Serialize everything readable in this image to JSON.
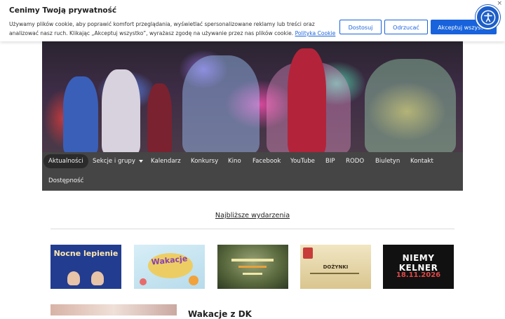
{
  "cookie_banner": {
    "title": "Cenimy Twoją prywatność",
    "text": "Używamy plików cookie, aby poprawić komfort przeglądania, wyświetlać spersonalizowane reklamy lub treści oraz analizować nasz ruch. Klikając „Akceptuj wszystko”, wyrażasz zgodę na używanie przez nas plików cookie.",
    "policy_link": "Polityka Cookie",
    "buttons": {
      "customize": "Dostosuj",
      "reject": "Odrzucać",
      "accept_all": "Akceptuj wszystko"
    },
    "close": "×"
  },
  "accessibility_widget": {
    "icon": "accessibility-icon"
  },
  "nav": {
    "items": [
      {
        "label": "Aktualności",
        "active": true
      },
      {
        "label": "Sekcje i grupy",
        "has_dropdown": true
      },
      {
        "label": "Kalendarz"
      },
      {
        "label": "Konkursy"
      },
      {
        "label": "Kino"
      },
      {
        "label": "Facebook"
      },
      {
        "label": "YouTube"
      },
      {
        "label": "BIP"
      },
      {
        "label": "RODO"
      },
      {
        "label": "Biuletyn"
      },
      {
        "label": "Kontakt"
      },
      {
        "label": "Dostępność"
      }
    ]
  },
  "events": {
    "heading": "Najbliższe wydarzenia",
    "items": [
      {
        "caption": "Nocne lepienie",
        "bg": "#223c8f"
      },
      {
        "caption": "Wakacje",
        "bg": "#cfe9f3"
      },
      {
        "caption": "",
        "bg": "#5b6b3f"
      },
      {
        "caption": "DOŻYNKI",
        "bg": "#e6d7a8"
      },
      {
        "caption": "NIEMY KELNER",
        "subcaption": "18.11.2026",
        "bg": "#111111"
      }
    ]
  },
  "featured": {
    "title": "Wakacje z DK"
  },
  "colors": {
    "accent": "#1863dc",
    "nav_bg": "#454545",
    "a11y": "#1d5ec9"
  }
}
